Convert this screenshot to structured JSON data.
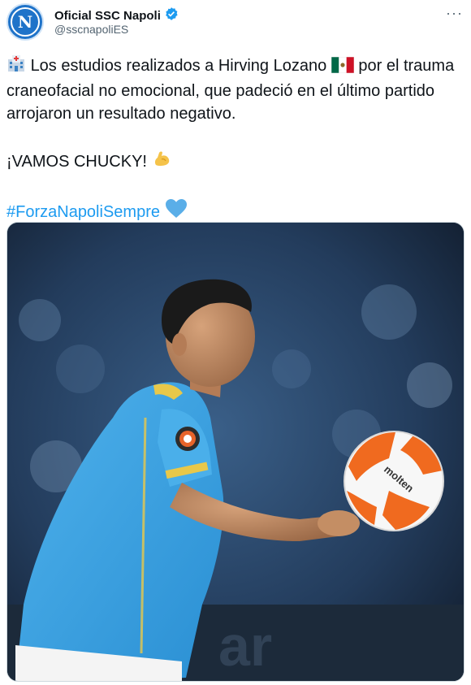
{
  "account": {
    "display_name": "Oficial SSC Napoli",
    "handle": "@sscnapoliES",
    "verified": true,
    "avatar_letter": "N",
    "avatar_color": "#1f73c9"
  },
  "tweet": {
    "line1": "Los estudios realizados a Hirving Lozano",
    "line1_after": "por el trauma craneofacial no emocional, que padeció en el último partido arrojaron un resultado negativo.",
    "line2": "¡VAMOS CHUCKY!",
    "hashtag": "#ForzaNapoliSempre"
  },
  "media": {
    "alt": "Player in light-blue Napoli shirt with a white and orange match ball",
    "jersey_color": "#3aa0e0",
    "ball_colors": [
      "#ffffff",
      "#f06a1f"
    ]
  },
  "colors": {
    "link": "#1d9bf0",
    "secondary_text": "#536471"
  }
}
